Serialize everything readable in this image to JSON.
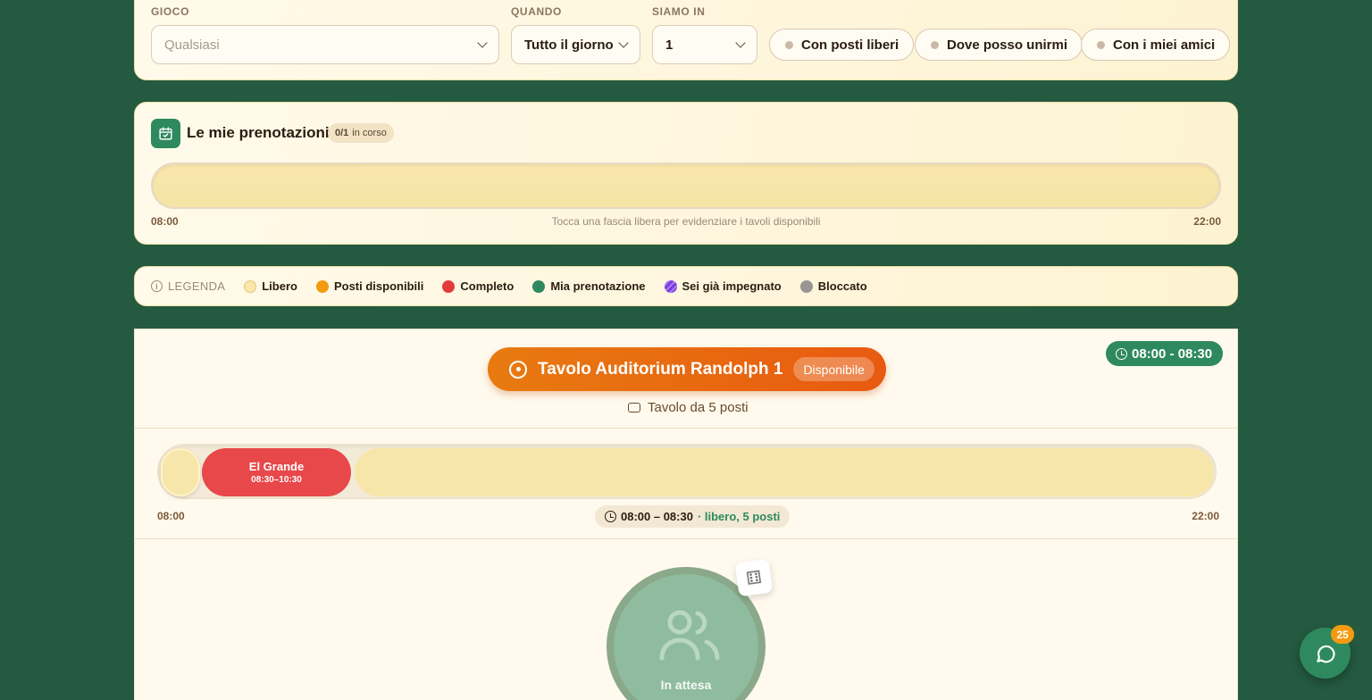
{
  "filters": {
    "game_label": "GIOCO",
    "game_placeholder": "Qualsiasi",
    "when_label": "QUANDO",
    "when_value": "Tutto il giorno",
    "group_label": "SIAMO IN",
    "group_value": "1",
    "chips": [
      "Con posti liberi",
      "Dove posso unirmi",
      "Con i miei amici"
    ]
  },
  "bookings": {
    "title": "Le mie prenotazioni",
    "count": "0/1",
    "count_suffix": "in corso",
    "start": "08:00",
    "end": "22:00",
    "hint": "Tocca una fascia libera per evidenziare i tavoli disponibili"
  },
  "legend": {
    "heading": "LEGENDA",
    "items": [
      {
        "label": "Libero",
        "color": "#f9e7ac"
      },
      {
        "label": "Posti disponibili",
        "color": "#f39a10"
      },
      {
        "label": "Completo",
        "color": "#e23a3a"
      },
      {
        "label": "Mia prenotazione",
        "color": "#2e8a5e"
      },
      {
        "label": "Sei già impegnato",
        "color": "#7a3ae2"
      },
      {
        "label": "Bloccato",
        "color": "#9a9592"
      }
    ]
  },
  "table": {
    "name": "Tavolo Auditorium Randolph 1",
    "status": "Disponibile",
    "time_range": "08:00 - 08:30",
    "seats_label": "Tavolo da 5 posti",
    "booking_game": "El Grande",
    "booking_time": "08:30–10:30",
    "start": "08:00",
    "end": "22:00",
    "slot_time": "08:00 – 08:30",
    "slot_status": "· libero, 5 posti",
    "waiting": "In attesa"
  },
  "chat": {
    "unread": "25"
  }
}
